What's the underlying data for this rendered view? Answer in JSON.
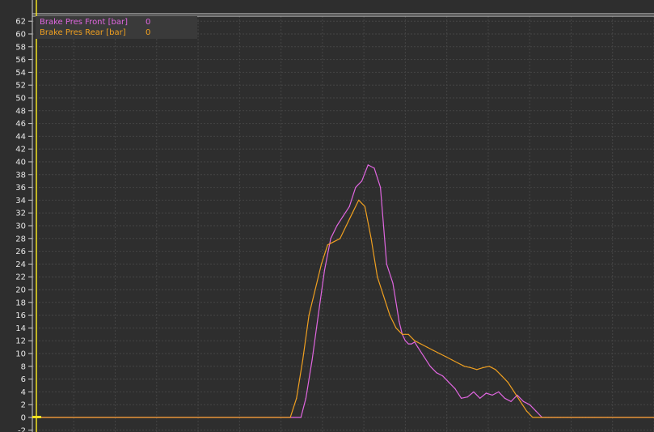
{
  "chart_data": {
    "type": "line",
    "title": "",
    "xlabel": "",
    "ylabel": "",
    "ylim": [
      -2,
      63
    ],
    "xlim": [
      0,
      100
    ],
    "grid": true,
    "legend": "top-left",
    "y_ticks": [
      -2,
      0,
      2,
      4,
      6,
      8,
      10,
      12,
      14,
      16,
      18,
      20,
      22,
      24,
      26,
      28,
      30,
      32,
      34,
      36,
      38,
      40,
      42,
      44,
      46,
      48,
      50,
      52,
      54,
      56,
      58,
      60,
      62
    ],
    "series": [
      {
        "name": "Brake Pres Front [bar]",
        "readout": "0",
        "color": "#e066e0",
        "x": [
          0,
          42,
          43.2,
          44,
          45,
          46,
          47,
          48,
          49,
          50,
          51,
          52,
          53,
          54,
          55,
          56,
          57,
          58,
          58.5,
          59,
          59.5,
          60,
          60.5,
          61,
          61.5,
          62,
          63,
          64,
          65,
          66,
          67,
          68,
          69,
          70,
          71,
          72,
          73,
          74,
          75,
          76,
          77,
          78,
          79,
          80,
          81,
          82,
          83,
          84,
          85,
          86,
          87,
          88,
          89,
          90,
          100
        ],
        "values": [
          0,
          0,
          0,
          3,
          9,
          16,
          23,
          28,
          30,
          31.5,
          33,
          36,
          37,
          39.5,
          39,
          36,
          24,
          21,
          18,
          15,
          13,
          12,
          11.5,
          11.5,
          11.8,
          11,
          9.5,
          8,
          7,
          6.5,
          5.5,
          4.5,
          3,
          3.2,
          4,
          3,
          3.8,
          3.5,
          4,
          3,
          2.5,
          3.5,
          2.5,
          2,
          1,
          0,
          0,
          0,
          0,
          0,
          0,
          0,
          0,
          0,
          0
        ]
      },
      {
        "name": "Brake Pres Rear [bar]",
        "readout": "0",
        "color": "#f0a020",
        "x": [
          0,
          41.5,
          42.5,
          43.5,
          44.5,
          45.5,
          46.5,
          47.5,
          48.5,
          49.5,
          50.5,
          51.5,
          52.5,
          53.5,
          54.5,
          55.5,
          56.5,
          57.5,
          58.5,
          59.5,
          60.5,
          61.5,
          62.5,
          63.5,
          64.5,
          65.5,
          66.5,
          67.5,
          68.5,
          69.5,
          70.5,
          71.5,
          72.5,
          73.5,
          74.5,
          75.5,
          76.5,
          77.5,
          78.5,
          79.5,
          80.5,
          81.5,
          82.5,
          83.5,
          84.5,
          85.5,
          86.5,
          87.5,
          88.5,
          89.5,
          90.5,
          91.5,
          92.5,
          100
        ],
        "values": [
          0,
          0,
          3,
          9,
          16,
          20,
          24,
          27,
          27.5,
          28,
          30,
          32,
          34,
          33,
          28,
          22,
          19,
          16,
          14,
          13,
          13,
          12,
          11.5,
          11,
          10.5,
          10,
          9.5,
          9,
          8.5,
          8,
          7.8,
          7.5,
          7.8,
          8,
          7.5,
          6.5,
          5.5,
          4,
          2.5,
          1,
          0,
          0,
          0,
          0,
          0,
          0,
          0,
          0,
          0,
          0,
          0,
          0,
          0,
          0
        ]
      }
    ]
  }
}
